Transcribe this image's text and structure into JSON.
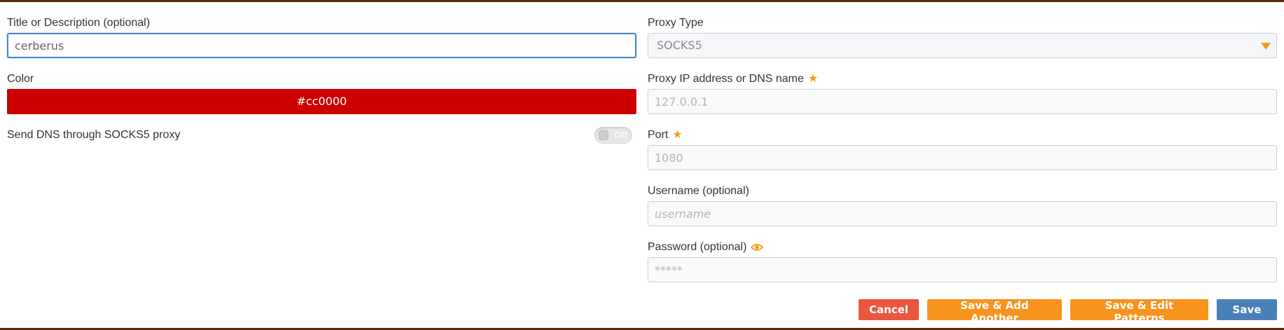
{
  "left": {
    "title": {
      "label": "Title or Description (optional)",
      "value": "cerberus"
    },
    "color": {
      "label": "Color",
      "value": "#cc0000",
      "hex": "#cc0000"
    },
    "dns": {
      "label": "Send DNS through SOCKS5 proxy",
      "toggle_text": "Off",
      "enabled": false
    }
  },
  "right": {
    "proxy_type": {
      "label": "Proxy Type",
      "value": "SOCKS5"
    },
    "address": {
      "label": "Proxy IP address or DNS name",
      "required_icon": "star-icon",
      "placeholder": "127.0.0.1"
    },
    "port": {
      "label": "Port",
      "required_icon": "star-icon",
      "placeholder": "1080"
    },
    "username": {
      "label": "Username (optional)",
      "placeholder": "username"
    },
    "password": {
      "label": "Password (optional)",
      "reveal_icon": "eye-icon",
      "placeholder": "*****"
    }
  },
  "buttons": {
    "cancel": "Cancel",
    "save_add": "Save & Add Another",
    "save_edit": "Save & Edit Patterns",
    "save": "Save"
  },
  "colors": {
    "accent_orange": "#f7931e",
    "cancel_red": "#e9573f",
    "save_blue": "#4a80b5",
    "frame_brown": "#5a2a0e"
  }
}
